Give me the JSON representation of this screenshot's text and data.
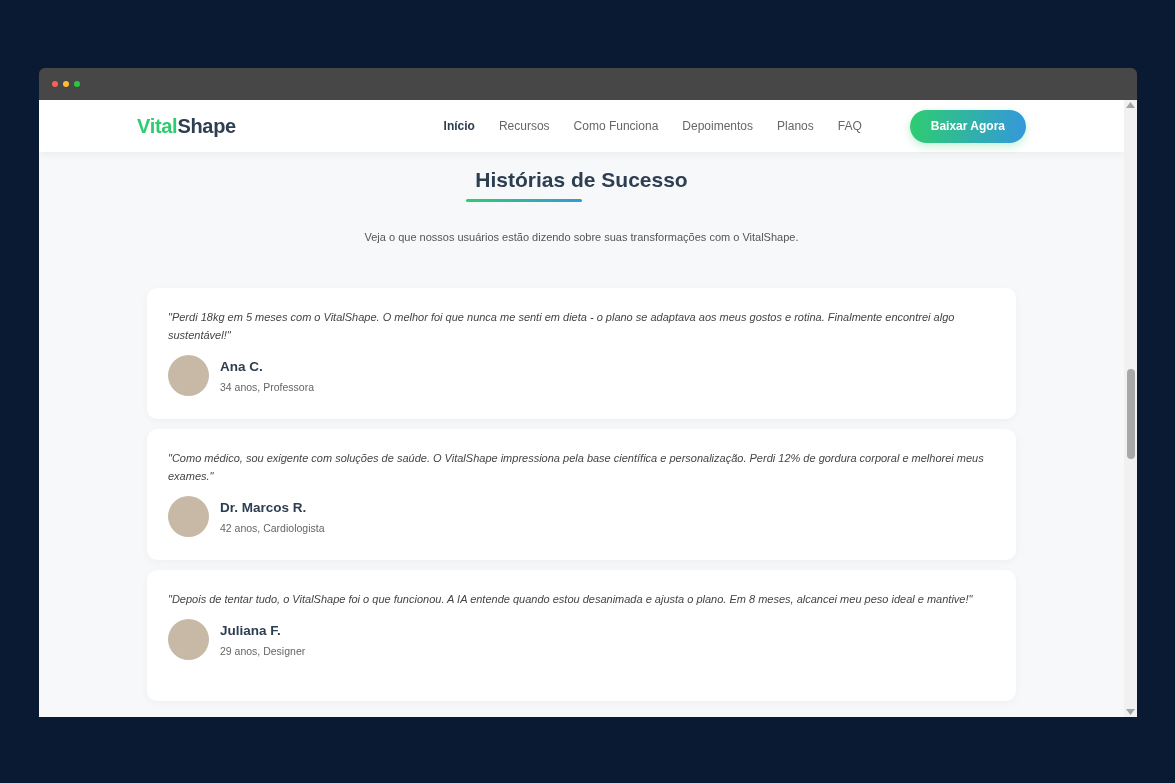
{
  "logo": {
    "accent": "Vital",
    "rest": "Shape"
  },
  "nav": {
    "items": [
      {
        "label": "Início",
        "selected": true
      },
      {
        "label": "Recursos",
        "selected": false
      },
      {
        "label": "Como Funciona",
        "selected": false
      },
      {
        "label": "Depoimentos",
        "selected": false
      },
      {
        "label": "Planos",
        "selected": false
      },
      {
        "label": "FAQ",
        "selected": false
      }
    ],
    "cta": "Baixar Agora"
  },
  "section": {
    "title": "Histórias de Sucesso",
    "subtitle": "Veja o que nossos usuários estão dizendo sobre suas transformações com o VitalShape."
  },
  "testimonials": [
    {
      "quote": "\"Perdi 18kg em 5 meses com o VitalShape. O melhor foi que nunca me senti em dieta - o plano se adaptava aos meus gostos e rotina. Finalmente encontrei algo sustentável!\"",
      "name": "Ana C.",
      "details": "34 anos, Professora"
    },
    {
      "quote": "\"Como médico, sou exigente com soluções de saúde. O VitalShape impressiona pela base científica e personalização. Perdi 12% de gordura corporal e melhorei meus exames.\"",
      "name": "Dr. Marcos R.",
      "details": "42 anos, Cardiologista"
    },
    {
      "quote": "\"Depois de tentar tudo, o VitalShape foi o que funcionou. A IA entende quando estou desanimada e ajusta o plano. Em 8 meses, alcancei meu peso ideal e mantive!\"",
      "name": "Juliana F.",
      "details": "29 anos, Designer"
    }
  ]
}
